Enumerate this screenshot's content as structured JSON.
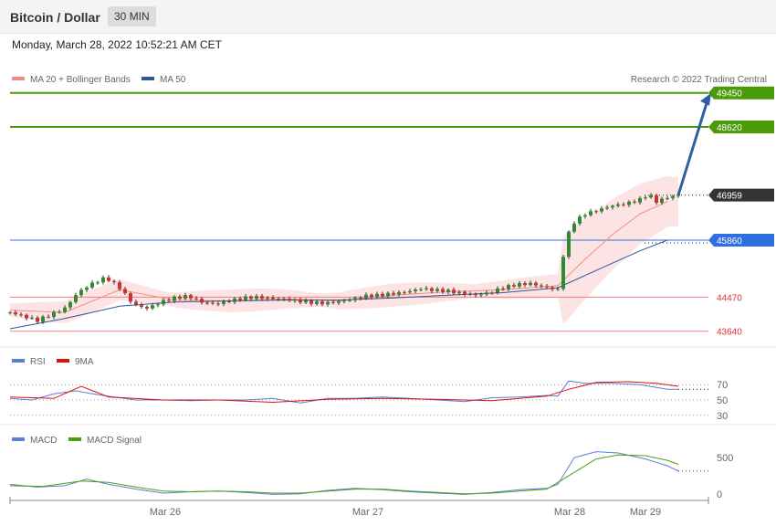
{
  "header": {
    "title": "Bitcoin / Dollar",
    "timeframe": "30 MIN"
  },
  "datetime": "Monday, March 28, 2022 10:52:21 AM CET",
  "legend": {
    "ma20": "MA 20 + Bollinger Bands",
    "ma50": "MA 50",
    "ma20_color": "#f28b82",
    "ma50_color": "#2f5597",
    "copyright": "Research © 2022 Trading Central"
  },
  "levels": [
    {
      "value": 49450,
      "label": "49450",
      "kind": "resistance",
      "color": "#4a9a0a"
    },
    {
      "value": 48620,
      "label": "48620",
      "kind": "resistance",
      "color": "#4a9a0a"
    },
    {
      "value": 46959,
      "label": "46959",
      "kind": "last",
      "color": "#333333"
    },
    {
      "value": 45860,
      "label": "45860",
      "kind": "pivot",
      "color": "#2f6fe0"
    },
    {
      "value": 44470,
      "label": "44470",
      "kind": "support",
      "color": "#e03030"
    },
    {
      "value": 43640,
      "label": "43640",
      "kind": "support",
      "color": "#e03030"
    }
  ],
  "rsi_legend": {
    "rsi": "RSI",
    "ma": "9MA",
    "rsi_color": "#5a7fd6",
    "ma_color": "#e01010"
  },
  "rsi_ticks": [
    "70",
    "50",
    "30"
  ],
  "macd_legend": {
    "macd": "MACD",
    "signal": "MACD Signal",
    "macd_color": "#5a7fd6",
    "signal_color": "#4aa010"
  },
  "macd_ticks": [
    "500",
    "0"
  ],
  "xaxis_labels": [
    "Mar 26",
    "Mar 27",
    "Mar 28",
    "Mar 29"
  ],
  "chart_data": {
    "type": "candlestick",
    "title": "Bitcoin / Dollar",
    "timeframe": "30 MIN",
    "price_range": [
      43300,
      50200
    ],
    "price_series": [
      [
        0,
        44100
      ],
      [
        5,
        44000
      ],
      [
        10,
        43900
      ],
      [
        15,
        44050
      ],
      [
        20,
        44200
      ],
      [
        25,
        44600
      ],
      [
        30,
        44800
      ],
      [
        35,
        44950
      ],
      [
        40,
        44700
      ],
      [
        45,
        44300
      ],
      [
        50,
        44200
      ],
      [
        55,
        44350
      ],
      [
        60,
        44450
      ],
      [
        65,
        44500
      ],
      [
        70,
        44350
      ],
      [
        75,
        44300
      ],
      [
        80,
        44380
      ],
      [
        85,
        44450
      ],
      [
        90,
        44470
      ],
      [
        95,
        44440
      ],
      [
        100,
        44420
      ],
      [
        105,
        44380
      ],
      [
        110,
        44340
      ],
      [
        115,
        44320
      ],
      [
        120,
        44360
      ],
      [
        125,
        44420
      ],
      [
        130,
        44500
      ],
      [
        135,
        44520
      ],
      [
        140,
        44560
      ],
      [
        145,
        44600
      ],
      [
        150,
        44680
      ],
      [
        155,
        44640
      ],
      [
        160,
        44620
      ],
      [
        165,
        44560
      ],
      [
        170,
        44520
      ],
      [
        175,
        44580
      ],
      [
        180,
        44700
      ],
      [
        185,
        44780
      ],
      [
        190,
        44800
      ],
      [
        195,
        44720
      ],
      [
        200,
        44650
      ],
      [
        203,
        45900
      ],
      [
        206,
        46300
      ],
      [
        210,
        46500
      ],
      [
        215,
        46600
      ],
      [
        220,
        46700
      ],
      [
        225,
        46750
      ],
      [
        230,
        46850
      ],
      [
        233,
        46980
      ],
      [
        236,
        46800
      ],
      [
        240,
        46900
      ],
      [
        244,
        46959
      ]
    ],
    "ma20": [
      [
        0,
        44150
      ],
      [
        20,
        44100
      ],
      [
        40,
        44650
      ],
      [
        60,
        44400
      ],
      [
        80,
        44380
      ],
      [
        100,
        44430
      ],
      [
        120,
        44380
      ],
      [
        140,
        44520
      ],
      [
        160,
        44600
      ],
      [
        180,
        44650
      ],
      [
        200,
        44750
      ],
      [
        210,
        45400
      ],
      [
        220,
        46000
      ],
      [
        230,
        46500
      ],
      [
        240,
        46800
      ]
    ],
    "ma50": [
      [
        0,
        43700
      ],
      [
        20,
        43950
      ],
      [
        40,
        44250
      ],
      [
        60,
        44350
      ],
      [
        80,
        44380
      ],
      [
        100,
        44400
      ],
      [
        120,
        44400
      ],
      [
        140,
        44450
      ],
      [
        160,
        44520
      ],
      [
        180,
        44580
      ],
      [
        200,
        44700
      ],
      [
        210,
        45000
      ],
      [
        220,
        45300
      ],
      [
        230,
        45600
      ],
      [
        240,
        45860
      ]
    ],
    "projection": {
      "from": [
        244,
        46959
      ],
      "to": [
        256,
        49450
      ]
    },
    "rsi_range": [
      20,
      80
    ],
    "rsi": [
      [
        0,
        52
      ],
      [
        8,
        50
      ],
      [
        16,
        58
      ],
      [
        24,
        62
      ],
      [
        30,
        58
      ],
      [
        38,
        54
      ],
      [
        46,
        50
      ],
      [
        56,
        50
      ],
      [
        66,
        49
      ],
      [
        76,
        50
      ],
      [
        86,
        50
      ],
      [
        96,
        52
      ],
      [
        106,
        46
      ],
      [
        116,
        52
      ],
      [
        126,
        52
      ],
      [
        136,
        54
      ],
      [
        146,
        52
      ],
      [
        156,
        50
      ],
      [
        166,
        48
      ],
      [
        176,
        53
      ],
      [
        186,
        54
      ],
      [
        196,
        56
      ],
      [
        200,
        55
      ],
      [
        204,
        75
      ],
      [
        210,
        72
      ],
      [
        220,
        72
      ],
      [
        230,
        70
      ],
      [
        240,
        64
      ],
      [
        244,
        64
      ]
    ],
    "rsi_ma": [
      [
        0,
        54
      ],
      [
        16,
        52
      ],
      [
        26,
        68
      ],
      [
        36,
        54
      ],
      [
        56,
        50
      ],
      [
        76,
        50
      ],
      [
        96,
        47
      ],
      [
        116,
        51
      ],
      [
        136,
        52
      ],
      [
        156,
        51
      ],
      [
        176,
        49
      ],
      [
        196,
        55
      ],
      [
        204,
        64
      ],
      [
        214,
        73
      ],
      [
        226,
        74
      ],
      [
        236,
        72
      ],
      [
        244,
        68
      ]
    ],
    "macd_range": [
      -120,
      700
    ],
    "macd": [
      [
        0,
        120
      ],
      [
        10,
        80
      ],
      [
        20,
        100
      ],
      [
        28,
        200
      ],
      [
        36,
        120
      ],
      [
        46,
        50
      ],
      [
        56,
        -10
      ],
      [
        66,
        10
      ],
      [
        76,
        20
      ],
      [
        86,
        0
      ],
      [
        96,
        -30
      ],
      [
        106,
        -20
      ],
      [
        116,
        30
      ],
      [
        126,
        60
      ],
      [
        136,
        40
      ],
      [
        146,
        10
      ],
      [
        156,
        -10
      ],
      [
        166,
        -30
      ],
      [
        176,
        0
      ],
      [
        186,
        40
      ],
      [
        196,
        60
      ],
      [
        200,
        120
      ],
      [
        206,
        520
      ],
      [
        214,
        610
      ],
      [
        222,
        590
      ],
      [
        232,
        500
      ],
      [
        240,
        400
      ],
      [
        244,
        320
      ]
    ],
    "macd_signal": [
      [
        0,
        100
      ],
      [
        12,
        90
      ],
      [
        26,
        170
      ],
      [
        36,
        150
      ],
      [
        46,
        80
      ],
      [
        56,
        20
      ],
      [
        66,
        10
      ],
      [
        76,
        20
      ],
      [
        86,
        10
      ],
      [
        96,
        -10
      ],
      [
        106,
        -10
      ],
      [
        116,
        20
      ],
      [
        126,
        50
      ],
      [
        136,
        50
      ],
      [
        146,
        20
      ],
      [
        156,
        0
      ],
      [
        166,
        -20
      ],
      [
        176,
        -10
      ],
      [
        186,
        20
      ],
      [
        196,
        50
      ],
      [
        206,
        300
      ],
      [
        214,
        500
      ],
      [
        222,
        560
      ],
      [
        232,
        550
      ],
      [
        240,
        480
      ],
      [
        244,
        420
      ]
    ],
    "x_range": [
      0,
      255
    ]
  }
}
